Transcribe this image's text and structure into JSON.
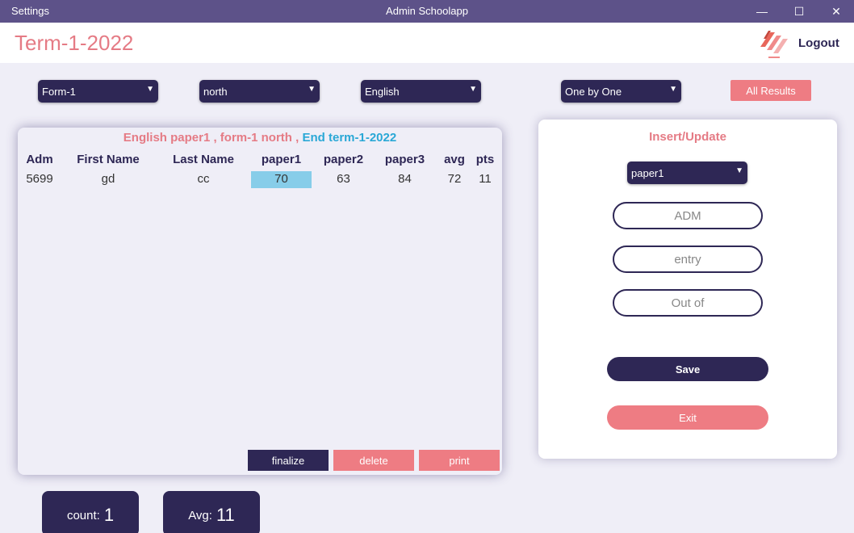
{
  "window": {
    "left_title": "Settings",
    "title": "Admin Schoolapp",
    "minimize": "—",
    "maximize": "☐",
    "close": "✕"
  },
  "header": {
    "page_title": "Term-1-2022",
    "logout": "Logout"
  },
  "filters": {
    "form": "Form-1",
    "stream": "north",
    "subject": "English",
    "mode": "One by One",
    "all_results": "All Results",
    "arrow": "▼"
  },
  "results": {
    "caption_main": "English paper1 , form-1 north ,",
    "caption_term": "End term-1-2022",
    "columns": [
      "Adm",
      "First Name",
      "Last Name",
      "paper1",
      "paper2",
      "paper3",
      "avg",
      "pts"
    ],
    "rows": [
      [
        "5699",
        "gd",
        "cc",
        "70",
        "63",
        "84",
        "72",
        "11"
      ]
    ],
    "finalize": "finalize",
    "delete": "delete",
    "print": "print"
  },
  "form": {
    "title": "Insert/Update",
    "paper_select": "paper1",
    "adm_placeholder": "ADM",
    "entry_placeholder": "entry",
    "outof_placeholder": "Out of",
    "save": "Save",
    "exit": "Exit"
  },
  "stats": {
    "count_label": "count:",
    "count_value": "1",
    "avg_label": "Avg:",
    "avg_value": "11"
  },
  "colors": {
    "primary": "#2e2755",
    "accent": "#ee7c83",
    "highlight": "#87cde9",
    "titlebar": "#5d5289"
  }
}
